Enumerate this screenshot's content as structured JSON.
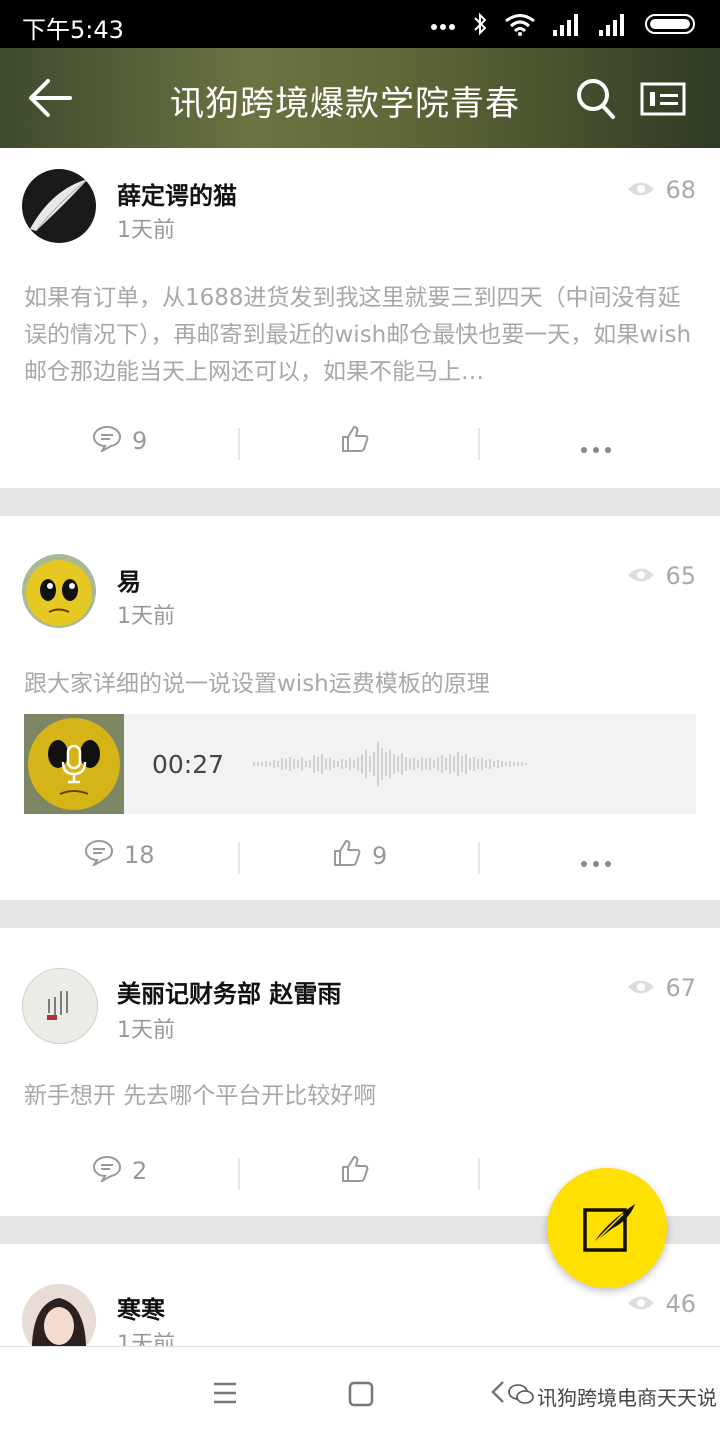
{
  "status_bar": {
    "time": "下午5:43"
  },
  "header": {
    "title": "讯狗跨境爆款学院青春"
  },
  "posts": [
    {
      "user": "薛定谔的猫",
      "time": "1天前",
      "views": "68",
      "text": "如果有订单，从1688进货发到我这里就要三到四天（中间没有延误的情况下），再邮寄到最近的wish邮仓最快也要一天，如果wish邮仓那边能当天上网还可以，如果不能马上…",
      "comments": "9",
      "likes": ""
    },
    {
      "user": "易",
      "time": "1天前",
      "views": "65",
      "text": "跟大家详细的说一说设置wish运费模板的原理",
      "voice_duration": "00:27",
      "comments": "18",
      "likes": "9"
    },
    {
      "user": "美丽记财务部 赵雷雨",
      "time": "1天前",
      "views": "67",
      "text": "新手想开 先去哪个平台开比较好啊",
      "comments": "2",
      "likes": ""
    },
    {
      "user": "寒寒",
      "time": "1天前",
      "views": "46"
    }
  ],
  "watermark": "讯狗跨境电商天天说",
  "icons": {
    "back": "back-arrow-icon",
    "search": "search-icon",
    "card": "profile-card-icon",
    "views": "eye-icon",
    "comment": "comment-icon",
    "like": "thumbs-up-icon",
    "more": "more-icon",
    "compose": "compose-quill-icon"
  },
  "colors": {
    "accent": "#ffe000",
    "text_muted": "#a8a8a8"
  }
}
